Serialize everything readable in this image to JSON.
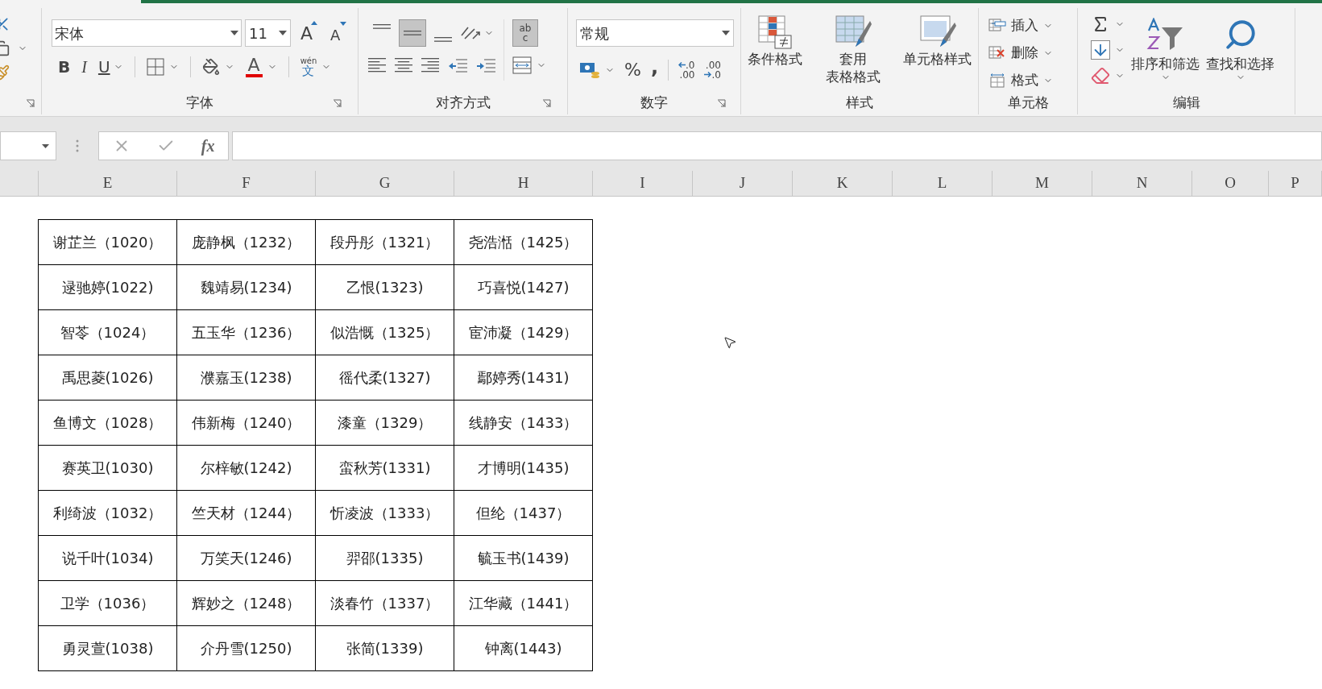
{
  "font_group": {
    "label": "字体",
    "font_name": "宋体",
    "font_size": "11",
    "grow_glyph": "A",
    "shrink_glyph": "A",
    "bold": "B",
    "italic": "I",
    "underline": "U",
    "font_color_glyph": "A",
    "phonetic_top": "wén",
    "phonetic_bottom": "文"
  },
  "alignment_group": {
    "label": "对齐方式",
    "vertical": [
      {
        "kind": "top",
        "selected": false
      },
      {
        "kind": "middle",
        "selected": true
      },
      {
        "kind": "bottom",
        "selected": false
      }
    ],
    "wrap": {
      "top": "ab",
      "bottom": "c",
      "selected": true
    }
  },
  "number_group": {
    "label": "数字",
    "format": "常规",
    "percent": "%",
    "comma": ",",
    "decimals": [
      {
        "kind": "increase",
        "top": ".0",
        "bottom": ".00"
      },
      {
        "kind": "decrease",
        "top": ".00",
        "bottom": ".0"
      }
    ]
  },
  "styles_group": {
    "label": "样式",
    "buttons": [
      {
        "kind": "conditional",
        "lines": [
          "条件格式"
        ]
      },
      {
        "kind": "table",
        "lines": [
          "套用",
          "表格格式"
        ]
      },
      {
        "kind": "cell",
        "lines": [
          "单元格样式"
        ]
      }
    ]
  },
  "cells_group": {
    "label": "单元格",
    "buttons": [
      {
        "kind": "insert",
        "label": "插入"
      },
      {
        "kind": "delete",
        "label": "删除"
      },
      {
        "kind": "format",
        "label": "格式"
      }
    ]
  },
  "editing_group": {
    "label": "编辑",
    "buttons": [
      {
        "kind": "sort",
        "label": "排序和筛选"
      },
      {
        "kind": "find",
        "label": "查找和选择"
      }
    ]
  },
  "formula_bar": {
    "fx": "fx"
  },
  "columns": [
    "E",
    "F",
    "G",
    "H",
    "I",
    "J",
    "K",
    "L",
    "M",
    "N",
    "O",
    "P"
  ],
  "table": {
    "rows": [
      [
        "谢芷兰（1020）",
        "庞静枫（1232）",
        "段丹彤（1321）",
        "尧浩湉（1425）"
      ],
      [
        "逯驰婷(1022)",
        "魏靖易(1234)",
        "乙恨(1323)",
        "巧喜悦(1427)"
      ],
      [
        "智苓（1024）",
        "五玉华（1236）",
        "似浩慨（1325）",
        "宦沛凝（1429）"
      ],
      [
        "禹思菱(1026)",
        "濮嘉玉(1238)",
        "徭代柔(1327)",
        "鄢婷秀(1431)"
      ],
      [
        "鱼博文（1028）",
        "伟新梅（1240）",
        "漆童（1329）",
        "线静安（1433）"
      ],
      [
        "赛英卫(1030)",
        "尔梓敏(1242)",
        "蛮秋芳(1331)",
        "才博明(1435)"
      ],
      [
        "利绮波（1032）",
        "竺天材（1244）",
        "忻凌波（1333）",
        "但纶（1437）"
      ],
      [
        "说千叶(1034)",
        "万笑天(1246)",
        "羿邵(1335)",
        "毓玉书(1439)"
      ],
      [
        "卫学（1036）",
        "辉妙之（1248）",
        "淡春竹（1337）",
        "江华藏（1441）"
      ],
      [
        "勇灵萱(1038)",
        "介丹雪(1250)",
        "张简(1339)",
        "钟离(1443)"
      ]
    ]
  }
}
